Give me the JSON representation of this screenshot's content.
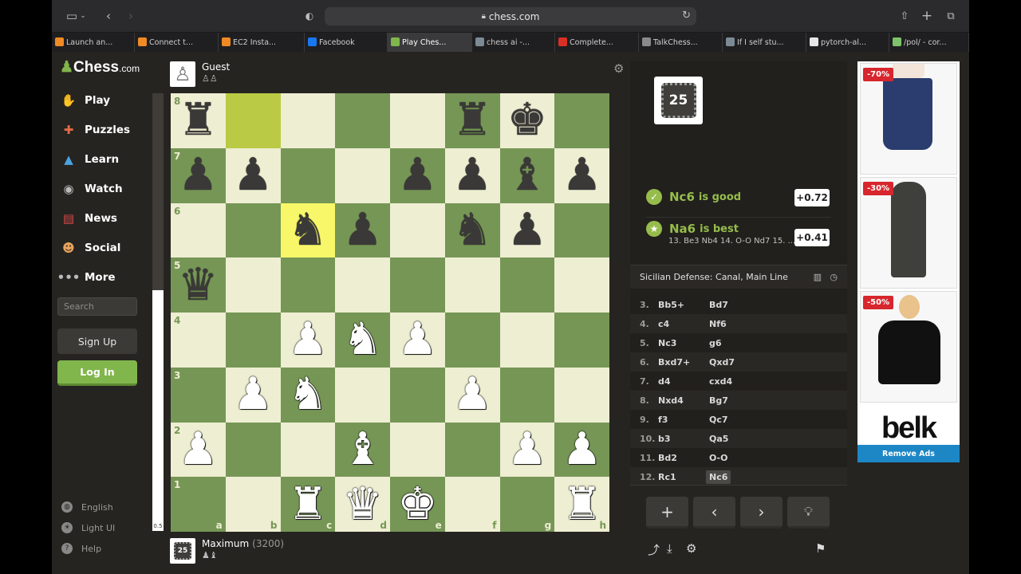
{
  "browser": {
    "url": "chess.com",
    "tabs": [
      {
        "label": "Launch an...",
        "color": "#f08a24",
        "active": false
      },
      {
        "label": "Connect t...",
        "color": "#f08a24",
        "active": false
      },
      {
        "label": "EC2 Insta...",
        "color": "#f08a24",
        "active": false
      },
      {
        "label": "Facebook",
        "color": "#1877f2",
        "active": false
      },
      {
        "label": "Play Ches...",
        "color": "#81b64c",
        "active": true
      },
      {
        "label": "chess ai -...",
        "color": "#7c8a96",
        "active": false
      },
      {
        "label": "Complete...",
        "color": "#d93025",
        "active": false
      },
      {
        "label": "TalkChess...",
        "color": "#8a8a8a",
        "active": false
      },
      {
        "label": "If I self stu...",
        "color": "#7c8a96",
        "active": false
      },
      {
        "label": "pytorch-al...",
        "color": "#e6e6e6",
        "active": false
      },
      {
        "label": "/pol/ - cor...",
        "color": "#7cc36b",
        "active": false
      }
    ]
  },
  "sidebar": {
    "logo": "Chess",
    "logo_suffix": ".com",
    "items": [
      {
        "label": "Play",
        "icon": "play-icon"
      },
      {
        "label": "Puzzles",
        "icon": "puzzle-icon"
      },
      {
        "label": "Learn",
        "icon": "learn-icon"
      },
      {
        "label": "Watch",
        "icon": "watch-icon"
      },
      {
        "label": "News",
        "icon": "news-icon"
      },
      {
        "label": "Social",
        "icon": "social-icon"
      },
      {
        "label": "More",
        "icon": "more-icon"
      }
    ],
    "search_placeholder": "Search",
    "signup": "Sign Up",
    "login": "Log In",
    "footer": [
      {
        "label": "English",
        "icon": "globe-icon"
      },
      {
        "label": "Light UI",
        "icon": "sun-icon"
      },
      {
        "label": "Help",
        "icon": "help-icon"
      }
    ]
  },
  "eval_bar": {
    "label": "0.5",
    "white_fraction": 0.55
  },
  "top_player": {
    "name": "Guest"
  },
  "bottom_player": {
    "name": "Maximum",
    "rating": "(3200)",
    "level": "25"
  },
  "board": {
    "ranks": [
      "8",
      "7",
      "6",
      "5",
      "4",
      "3",
      "2",
      "1"
    ],
    "files": [
      "a",
      "b",
      "c",
      "d",
      "e",
      "f",
      "g",
      "h"
    ],
    "rows": [
      [
        "r",
        "",
        "",
        "",
        "",
        "r",
        "k",
        ""
      ],
      [
        "p",
        "p",
        "",
        "",
        "p",
        "p",
        "b",
        "p"
      ],
      [
        "",
        "",
        "n",
        "p",
        "",
        "n",
        "p",
        ""
      ],
      [
        "q",
        "",
        "",
        "",
        "",
        "",
        "",
        ""
      ],
      [
        "",
        "",
        "P",
        "N",
        "P",
        "",
        "",
        ""
      ],
      [
        "",
        "P",
        "N",
        "",
        "",
        "P",
        "",
        ""
      ],
      [
        "P",
        "",
        "",
        "B",
        "",
        "",
        "P",
        "P"
      ],
      [
        "",
        "",
        "R",
        "Q",
        "K",
        "",
        "",
        "R"
      ]
    ],
    "highlights": [
      "b8",
      "c6"
    ]
  },
  "analysis": {
    "engine_level": "25",
    "good_move": "Nc6",
    "good_text": "is good",
    "good_eval": "+0.72",
    "best_move": "Na6",
    "best_text": "is best",
    "best_eval": "+0.41",
    "best_line": "13. Be3 Nb4 14. O-O Nd7 15. ...",
    "opening": "Sicilian Defense: Canal, Main Line"
  },
  "moves": [
    {
      "n": "3.",
      "w": "Bb5+",
      "b": "Bd7"
    },
    {
      "n": "4.",
      "w": "c4",
      "b": "Nf6"
    },
    {
      "n": "5.",
      "w": "Nc3",
      "b": "g6"
    },
    {
      "n": "6.",
      "w": "Bxd7+",
      "b": "Qxd7"
    },
    {
      "n": "7.",
      "w": "d4",
      "b": "cxd4"
    },
    {
      "n": "8.",
      "w": "Nxd4",
      "b": "Bg7"
    },
    {
      "n": "9.",
      "w": "f3",
      "b": "Qc7"
    },
    {
      "n": "10.",
      "w": "b3",
      "b": "Qa5"
    },
    {
      "n": "11.",
      "w": "Bd2",
      "b": "O-O"
    },
    {
      "n": "12.",
      "w": "Rc1",
      "b": "Nc6"
    }
  ],
  "ad": {
    "tags": [
      "-70%",
      "-30%",
      "-50%"
    ],
    "brand": "belk",
    "remove": "Remove Ads"
  }
}
